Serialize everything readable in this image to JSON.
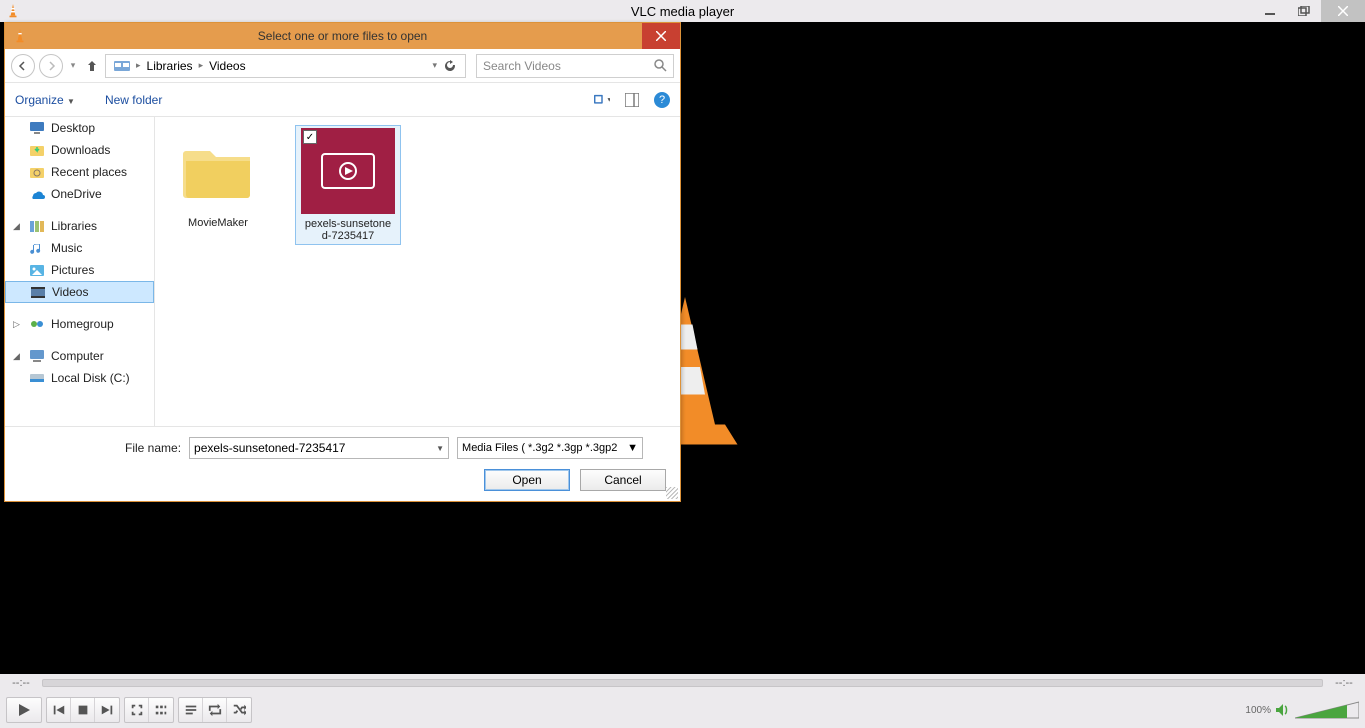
{
  "vlc": {
    "title": "VLC media player",
    "time_left": "--:--",
    "time_right": "--:--",
    "volume_pct": "100%"
  },
  "dialog": {
    "title": "Select one or more files to open",
    "breadcrumb": {
      "seg1": "Libraries",
      "seg2": "Videos"
    },
    "search_placeholder": "Search Videos",
    "toolbar": {
      "organize": "Organize",
      "new_folder": "New folder"
    },
    "sidebar": {
      "desktop": "Desktop",
      "downloads": "Downloads",
      "recent": "Recent places",
      "onedrive": "OneDrive",
      "libraries": "Libraries",
      "music": "Music",
      "pictures": "Pictures",
      "videos": "Videos",
      "homegroup": "Homegroup",
      "computer": "Computer",
      "localdisk": "Local Disk (C:)"
    },
    "files": {
      "folder1": "MovieMaker",
      "video1_line1": "pexels-sunsetone",
      "video1_line2": "d-7235417"
    },
    "footer": {
      "label": "File name:",
      "filename": "pexels-sunsetoned-7235417",
      "filetype": "Media Files ( *.3g2 *.3gp *.3gp2",
      "open": "Open",
      "cancel": "Cancel"
    }
  }
}
